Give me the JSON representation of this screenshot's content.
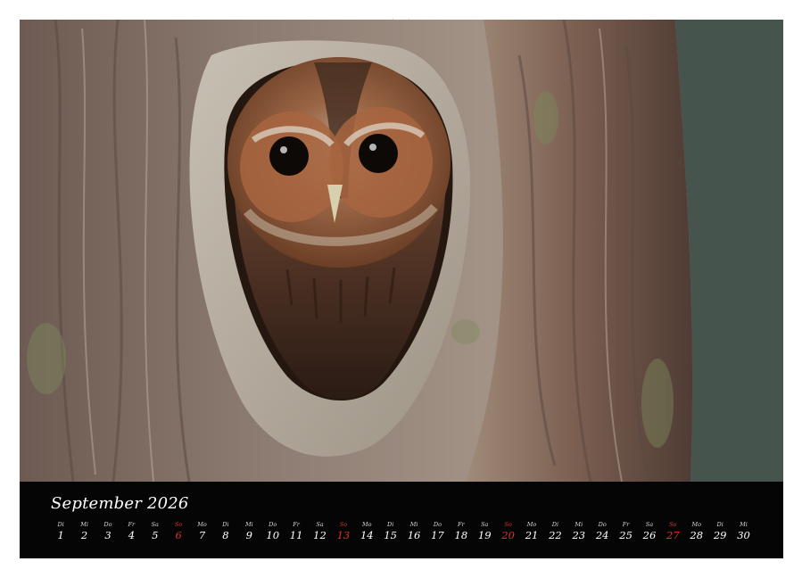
{
  "calendar": {
    "month_label": "September 2026",
    "days": [
      {
        "weekday": "Di",
        "day": "1"
      },
      {
        "weekday": "Mi",
        "day": "2"
      },
      {
        "weekday": "Do",
        "day": "3"
      },
      {
        "weekday": "Fr",
        "day": "4"
      },
      {
        "weekday": "Sa",
        "day": "5"
      },
      {
        "weekday": "So",
        "day": "6",
        "sunday": true
      },
      {
        "weekday": "Mo",
        "day": "7"
      },
      {
        "weekday": "Di",
        "day": "8"
      },
      {
        "weekday": "Mi",
        "day": "9"
      },
      {
        "weekday": "Do",
        "day": "10"
      },
      {
        "weekday": "Fr",
        "day": "11"
      },
      {
        "weekday": "Sa",
        "day": "12"
      },
      {
        "weekday": "So",
        "day": "13",
        "sunday": true
      },
      {
        "weekday": "Mo",
        "day": "14"
      },
      {
        "weekday": "Di",
        "day": "15"
      },
      {
        "weekday": "Mi",
        "day": "16"
      },
      {
        "weekday": "Do",
        "day": "17"
      },
      {
        "weekday": "Fr",
        "day": "18"
      },
      {
        "weekday": "Sa",
        "day": "19"
      },
      {
        "weekday": "So",
        "day": "20",
        "sunday": true
      },
      {
        "weekday": "Mo",
        "day": "21"
      },
      {
        "weekday": "Di",
        "day": "22"
      },
      {
        "weekday": "Mi",
        "day": "23"
      },
      {
        "weekday": "Do",
        "day": "24"
      },
      {
        "weekday": "Fr",
        "day": "25"
      },
      {
        "weekday": "Sa",
        "day": "26"
      },
      {
        "weekday": "So",
        "day": "27",
        "sunday": true
      },
      {
        "weekday": "Mo",
        "day": "28"
      },
      {
        "weekday": "Di",
        "day": "29"
      },
      {
        "weekday": "Mi",
        "day": "30"
      }
    ]
  },
  "colors": {
    "sunday": "#e0322b",
    "strip_background": "#050505",
    "text": "#ffffff"
  },
  "photo": {
    "subject_icon": "owl-in-tree-hollow-photo"
  }
}
